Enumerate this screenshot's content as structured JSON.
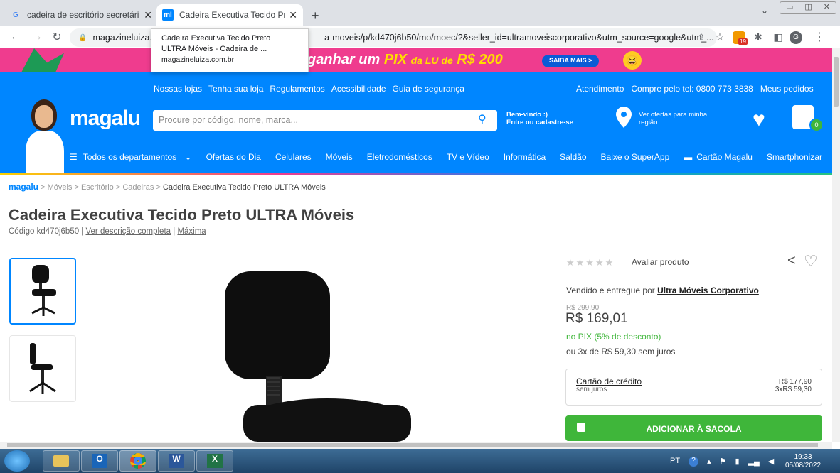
{
  "browser": {
    "tabs": [
      {
        "title": "cadeira de escritório secretária - ",
        "favicon": "G"
      },
      {
        "title": "Cadeira Executiva Tecido Preto UL",
        "favicon": "ml"
      }
    ],
    "url_prefix": "magazineluiza.c",
    "url_suffix": "a-moveis/p/kd470j6b50/mo/moec/?&seller_id=ultramoveiscorporativo&utm_source=google&utm_...",
    "tooltip": {
      "line1": "Cadeira Executiva Tecido Preto",
      "line2": "ULTRA Móveis - Cadeira de ...",
      "domain": "magazineluiza.com.br"
    },
    "ext_badge": "19",
    "profile": "G"
  },
  "promo": {
    "pre": "ganhar um",
    "brand": "PIX",
    "mid": "da LU de",
    "amount": "R$ 200",
    "cta": "SAIBA MAIS >"
  },
  "header": {
    "top_links": [
      "Nossas lojas",
      "Tenha sua loja",
      "Regulamentos",
      "Acessibilidade",
      "Guia de segurança"
    ],
    "right_links": [
      "Atendimento",
      "Compre pelo tel: 0800 773 3838",
      "Meus pedidos"
    ],
    "logo": "magalu",
    "search_placeholder": "Procure por código, nome, marca...",
    "welcome_line1": "Bem-vindo :)",
    "welcome_line2": "Entre ou cadastre-se",
    "offers_line1": "Ver ofertas para minha",
    "offers_line2": "região",
    "cart_count": "0",
    "nav": [
      "Todos os departamentos",
      "Ofertas do Dia",
      "Celulares",
      "Móveis",
      "Eletrodomésticos",
      "TV e Vídeo",
      "Informática",
      "Saldão",
      "Baixe o SuperApp",
      "Cartão Magalu",
      "Smartphonizar"
    ]
  },
  "breadcrumb": {
    "brand": "magalu",
    "items": [
      "Móveis",
      "Escritório",
      "Cadeiras"
    ],
    "current": "Cadeira Executiva Tecido Preto ULTRA Móveis"
  },
  "product": {
    "title": "Cadeira Executiva Tecido Preto ULTRA Móveis",
    "code": "Código kd470j6b50",
    "desc_link": "Ver descrição completa",
    "brand_link": "Máxima",
    "rating_label": "Avaliar produto",
    "seller_prefix": "Vendido e entregue por",
    "seller": "Ultra Móveis Corporativo",
    "old_price": "R$ 299,90",
    "price": "R$ 169,01",
    "pix_prefix": "no PIX",
    "pix_discount": "(5% de desconto)",
    "installments": "ou 3x de R$ 59,30 sem juros",
    "card_name": "Cartão de crédito",
    "card_sub": "sem juros",
    "card_total": "R$ 177,90",
    "card_inst": "3xR$ 59,30",
    "add_button": "ADICIONAR À SACOLA"
  },
  "taskbar": {
    "lang": "PT",
    "time": "19:33",
    "date": "05/08/2022"
  }
}
